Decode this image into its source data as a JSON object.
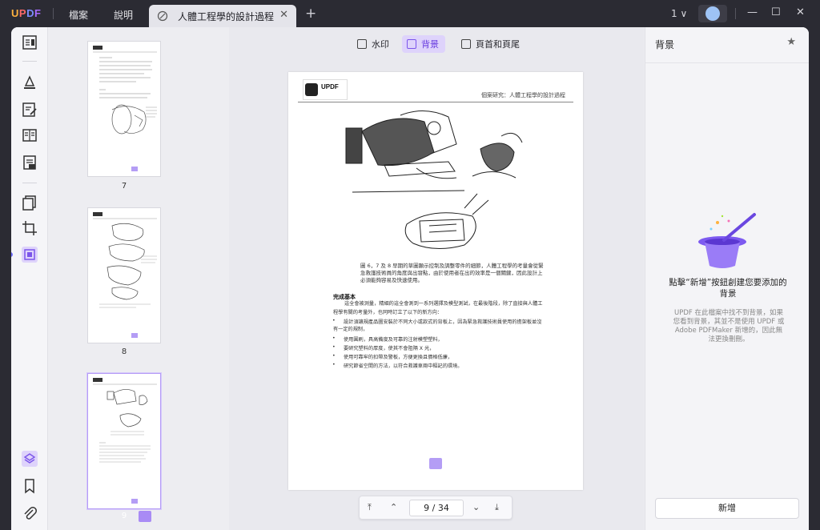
{
  "titlebar": {
    "menu": [
      "檔案",
      "說明"
    ],
    "tab_title": "人體工程學的設計過程",
    "tab_close": "✕",
    "new_tab": "+",
    "version": "1 ∨",
    "minimize": "—",
    "maximize": "☐",
    "close": "✕"
  },
  "thumbnails": [
    {
      "number": "7"
    },
    {
      "number": "8"
    },
    {
      "number": "9"
    }
  ],
  "subtoolbar": {
    "watermark": "水印",
    "background": "背景",
    "header_footer": "頁首和頁尾"
  },
  "page": {
    "header_text": "個案研究：人體工程學的設計過程",
    "caption": "圖 6，7 及 8 早期的草圖顯示控制及調整零件的細節，人體工程學的考量會從緊急救護技術員的角度與出發點，由於使用者在出的效率是一個關鍵，因此設計上必須能夠容易及快速使用。",
    "section_title": "完成基本",
    "para": "這全會被測量，精細的這全會測到一系列選擇及模型測試，在最後階段，除了直接與人體工程學有關的考量外，也同時訂立了以下的新方向：",
    "bullets": [
      "設計須讓規產品圖安裝於不同大小或款式的背板上，因為緊急救護技術員使用的擔架板並沒有一定的規制，",
      "使用圓刷，具高備度及可靠的注射模塑塑料，",
      "要研究塑料的厚度，使其不會阻隔 X 光，",
      "使用可靠牢的扣帶及警板，方便更換且價格低廉，",
      "研究節省空間的方法，以符合救護車兩中樞記的環境。"
    ]
  },
  "pager": {
    "current": "9",
    "separator": "/",
    "total": "34"
  },
  "right_panel": {
    "title": "背景",
    "message": "點擊“新增”按鈕創建您要添加的背景",
    "sub": "UPDF 在此檔案中找不到背景，如果您看到背景，其並不是使用 UPDF 或 Adobe PDFMaker 新增的，因此無法更換刪刪。",
    "add_button": "新增"
  },
  "colors": {
    "accent": "#7b55ea",
    "accent_light": "#ded3fb"
  }
}
